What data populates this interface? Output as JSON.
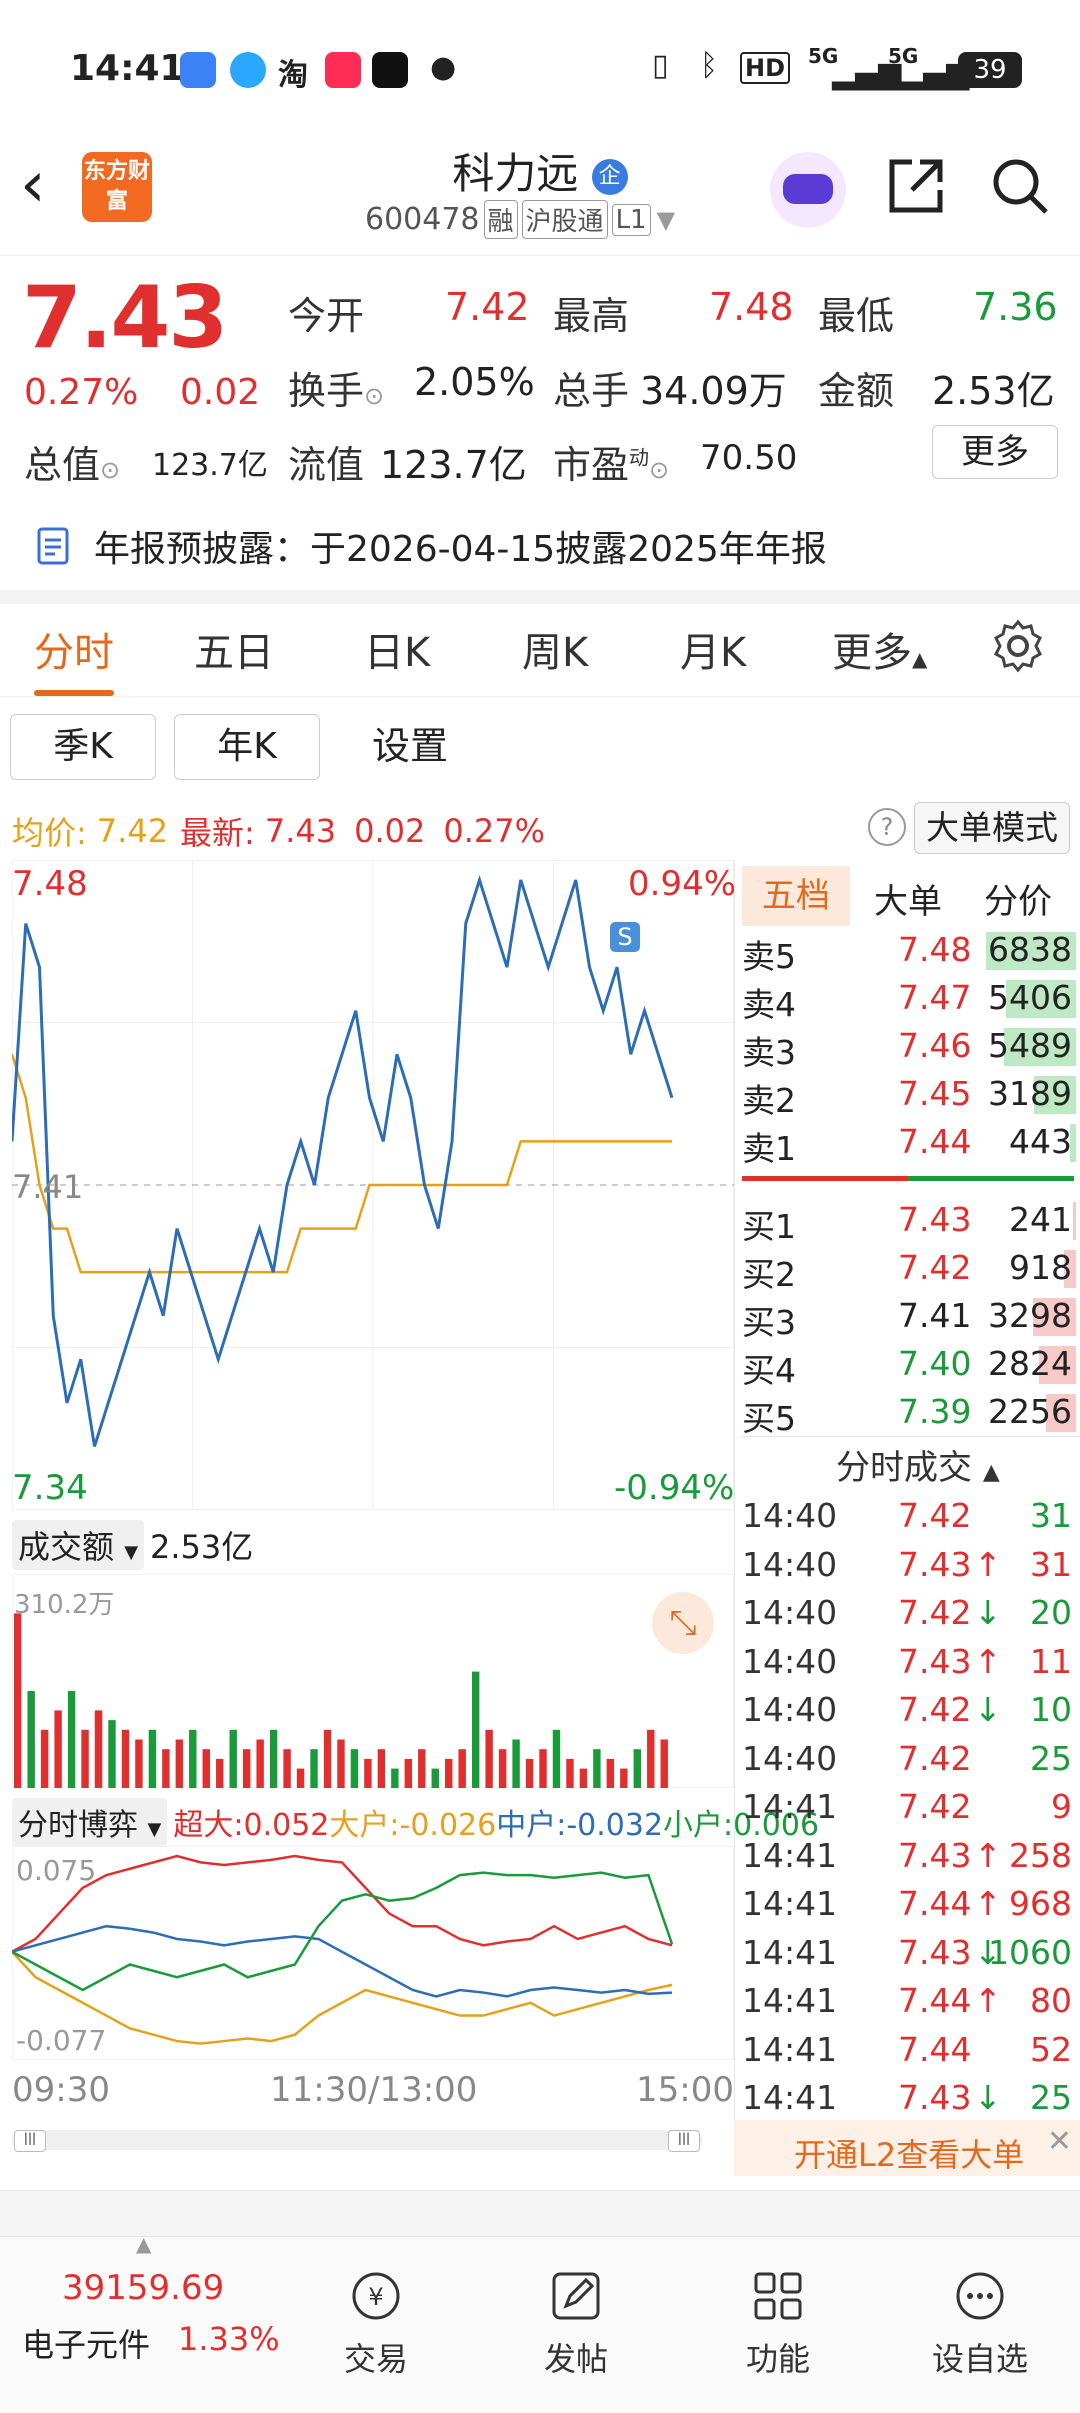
{
  "status_bar": {
    "time": "14:41",
    "battery": "39",
    "signal_1": "5G",
    "signal_2": "5G"
  },
  "header": {
    "logo_text": "东方财富",
    "stock_name": "科力远",
    "badge": "企",
    "code": "600478",
    "tag_rong": "融",
    "tag_connect": "沪股通",
    "tag_level": "L1"
  },
  "quote": {
    "price": "7.43",
    "change_pct": "0.27%",
    "change": "0.02",
    "open_label": "今开",
    "open": "7.42",
    "high_label": "最高",
    "high": "7.48",
    "low_label": "最低",
    "low": "7.36",
    "turnover_label": "换手",
    "turnover": "2.05%",
    "volume_label": "总手",
    "volume": "34.09万",
    "amount_label": "金额",
    "amount": "2.53亿",
    "mktcap_label": "总值",
    "mktcap": "123.7亿",
    "float_label": "流值",
    "float_cap": "123.7亿",
    "pe_label": "市盈",
    "pe_sup": "动",
    "pe": "70.50",
    "more_label": "更多"
  },
  "notice": {
    "text": "年报预披露：于2026-04-15披露2025年年报"
  },
  "tabs": [
    "分时",
    "五日",
    "日K",
    "周K",
    "月K",
    "更多"
  ],
  "sub_buttons": [
    "季K",
    "年K",
    "设置"
  ],
  "chart_info": {
    "avg_label": "均价:",
    "avg": "7.42",
    "latest_label": "最新:",
    "latest": "7.43",
    "change": "0.02",
    "change_pct": "0.27%",
    "mode_button": "大单模式"
  },
  "chart_axis": {
    "top_price": "7.48",
    "top_pct": "0.94%",
    "mid_price": "7.41",
    "bottom_price": "7.34",
    "bottom_pct": "-0.94%",
    "vol_selector": "成交额",
    "vol_total": "2.53亿",
    "vol_max": "310.2万",
    "flow_selector": "分时博弈",
    "flow_super": "超大:0.052",
    "flow_large": "大户:-0.026",
    "flow_mid": "中户:-0.032",
    "flow_small": "小户:0.006",
    "flow_top": "0.075",
    "flow_bottom": "-0.077",
    "time_start": "09:30",
    "time_mid": "11:30/13:00",
    "time_end": "15:00",
    "signal_marker": "S"
  },
  "orderbook": {
    "tabs": [
      "五档",
      "大单",
      "分价"
    ],
    "asks": [
      {
        "label": "卖5",
        "price": "7.48",
        "vol": "6838",
        "pct": 0.9
      },
      {
        "label": "卖4",
        "price": "7.47",
        "vol": "5406",
        "pct": 0.7
      },
      {
        "label": "卖3",
        "price": "7.46",
        "vol": "5489",
        "pct": 0.72
      },
      {
        "label": "卖2",
        "price": "7.45",
        "vol": "3189",
        "pct": 0.42
      },
      {
        "label": "卖1",
        "price": "7.44",
        "vol": "443",
        "pct": 0.06
      }
    ],
    "bids": [
      {
        "label": "买1",
        "price": "7.43",
        "vol": "241",
        "pct": 0.03
      },
      {
        "label": "买2",
        "price": "7.42",
        "vol": "918",
        "pct": 0.12
      },
      {
        "label": "买3",
        "price": "7.41",
        "vol": "3298",
        "pct": 0.43
      },
      {
        "label": "买4",
        "price": "7.40",
        "vol": "2824",
        "pct": 0.37
      },
      {
        "label": "买5",
        "price": "7.39",
        "vol": "2256",
        "pct": 0.3
      }
    ]
  },
  "ticks_header": "分时成交",
  "ticks": [
    {
      "time": "14:40",
      "price": "7.42",
      "arrow": "",
      "vol": "31",
      "vc": "green"
    },
    {
      "time": "14:40",
      "price": "7.43",
      "arrow": "↑",
      "vol": "31",
      "vc": "red"
    },
    {
      "time": "14:40",
      "price": "7.42",
      "arrow": "↓",
      "vol": "20",
      "vc": "green"
    },
    {
      "time": "14:40",
      "price": "7.43",
      "arrow": "↑",
      "vol": "11",
      "vc": "red"
    },
    {
      "time": "14:40",
      "price": "7.42",
      "arrow": "↓",
      "vol": "10",
      "vc": "green"
    },
    {
      "time": "14:40",
      "price": "7.42",
      "arrow": "",
      "vol": "25",
      "vc": "green"
    },
    {
      "time": "14:41",
      "price": "7.42",
      "arrow": "",
      "vol": "9",
      "vc": "red"
    },
    {
      "time": "14:41",
      "price": "7.43",
      "arrow": "↑",
      "vol": "258",
      "vc": "red"
    },
    {
      "time": "14:41",
      "price": "7.44",
      "arrow": "↑",
      "vol": "968",
      "vc": "red"
    },
    {
      "time": "14:41",
      "price": "7.43",
      "arrow": "↓",
      "vol": "1060",
      "vc": "green"
    },
    {
      "time": "14:41",
      "price": "7.44",
      "arrow": "↑",
      "vol": "80",
      "vc": "red"
    },
    {
      "time": "14:41",
      "price": "7.44",
      "arrow": "",
      "vol": "52",
      "vc": "red"
    },
    {
      "time": "14:41",
      "price": "7.43",
      "arrow": "↓",
      "vol": "25",
      "vc": "green"
    }
  ],
  "l2_banner": "开通L2查看大单",
  "bottom": {
    "index_value": "39159.69",
    "index_name": "电子元件",
    "index_pct": "1.33%",
    "nav": [
      "交易",
      "发帖",
      "功能",
      "设自选"
    ]
  },
  "colors": {
    "up": "#e02f2f",
    "down": "#1a9a3a",
    "accent": "#e26a1f",
    "price_line": "#2d6db5",
    "avg_line": "#e6a11c"
  },
  "price_series": [
    7.42,
    7.47,
    7.46,
    7.38,
    7.36,
    7.37,
    7.35,
    7.36,
    7.37,
    7.38,
    7.39,
    7.38,
    7.4,
    7.39,
    7.38,
    7.37,
    7.38,
    7.39,
    7.4,
    7.39,
    7.41,
    7.42,
    7.41,
    7.43,
    7.44,
    7.45,
    7.43,
    7.42,
    7.44,
    7.43,
    7.41,
    7.4,
    7.42,
    7.47,
    7.48,
    7.47,
    7.46,
    7.48,
    7.47,
    7.46,
    7.47,
    7.48,
    7.46,
    7.45,
    7.46,
    7.44,
    7.45,
    7.44,
    7.43
  ],
  "avg_series": [
    7.44,
    7.43,
    7.41,
    7.4,
    7.4,
    7.39,
    7.39,
    7.39,
    7.39,
    7.39,
    7.39,
    7.39,
    7.39,
    7.39,
    7.39,
    7.39,
    7.39,
    7.39,
    7.39,
    7.39,
    7.39,
    7.4,
    7.4,
    7.4,
    7.4,
    7.4,
    7.41,
    7.41,
    7.41,
    7.41,
    7.41,
    7.41,
    7.41,
    7.41,
    7.41,
    7.41,
    7.41,
    7.42,
    7.42,
    7.42,
    7.42,
    7.42,
    7.42,
    7.42,
    7.42,
    7.42,
    7.42,
    7.42,
    7.42
  ],
  "volume_series": [
    0.9,
    0.5,
    0.3,
    0.4,
    0.5,
    0.3,
    0.4,
    0.35,
    0.3,
    0.25,
    0.3,
    0.2,
    0.25,
    0.3,
    0.2,
    0.15,
    0.3,
    0.2,
    0.25,
    0.3,
    0.2,
    0.1,
    0.2,
    0.3,
    0.25,
    0.2,
    0.15,
    0.2,
    0.1,
    0.15,
    0.2,
    0.1,
    0.15,
    0.2,
    0.6,
    0.3,
    0.2,
    0.25,
    0.15,
    0.2,
    0.3,
    0.15,
    0.1,
    0.2,
    0.15,
    0.1,
    0.2,
    0.3,
    0.25
  ],
  "flow_series": {
    "super": [
      0,
      0.01,
      0.03,
      0.05,
      0.06,
      0.065,
      0.07,
      0.075,
      0.07,
      0.068,
      0.07,
      0.072,
      0.075,
      0.072,
      0.07,
      0.05,
      0.03,
      0.02,
      0.02,
      0.01,
      0.005,
      0.008,
      0.01,
      0.02,
      0.01,
      0.015,
      0.02,
      0.01,
      0.005
    ],
    "large": [
      0,
      -0.02,
      -0.03,
      -0.04,
      -0.05,
      -0.06,
      -0.065,
      -0.07,
      -0.072,
      -0.07,
      -0.068,
      -0.07,
      -0.065,
      -0.05,
      -0.04,
      -0.03,
      -0.035,
      -0.04,
      -0.045,
      -0.05,
      -0.05,
      -0.045,
      -0.04,
      -0.05,
      -0.045,
      -0.04,
      -0.035,
      -0.03,
      -0.026
    ],
    "mid": [
      0,
      0.005,
      0.01,
      0.015,
      0.02,
      0.018,
      0.015,
      0.01,
      0.008,
      0.005,
      0.008,
      0.01,
      0.012,
      0.01,
      0.0,
      -0.01,
      -0.02,
      -0.03,
      -0.035,
      -0.03,
      -0.032,
      -0.035,
      -0.03,
      -0.028,
      -0.03,
      -0.032,
      -0.03,
      -0.033,
      -0.032
    ],
    "small": [
      0,
      -0.01,
      -0.02,
      -0.03,
      -0.02,
      -0.01,
      -0.015,
      -0.02,
      -0.015,
      -0.01,
      -0.02,
      -0.015,
      -0.01,
      0.02,
      0.04,
      0.045,
      0.04,
      0.042,
      0.05,
      0.06,
      0.062,
      0.06,
      0.06,
      0.058,
      0.06,
      0.062,
      0.058,
      0.06,
      0.006
    ]
  }
}
